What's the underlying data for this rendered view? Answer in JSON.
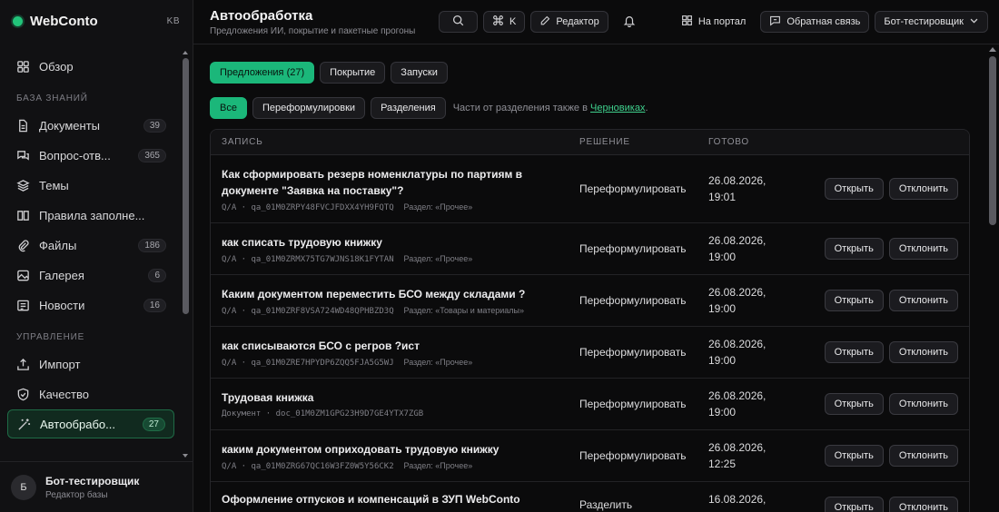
{
  "sidebar": {
    "brand": "WebConto",
    "kb_badge": "KB",
    "top_item": {
      "label": "Обзор"
    },
    "sections": [
      {
        "title": "БАЗА ЗНАНИЙ",
        "items": [
          {
            "label": "Документы",
            "count": "39",
            "icon": "document-icon"
          },
          {
            "label": "Вопрос-отв...",
            "count": "365",
            "icon": "chat-icon"
          },
          {
            "label": "Темы",
            "count": "",
            "icon": "layers-icon"
          },
          {
            "label": "Правила заполне...",
            "count": "",
            "icon": "book-icon"
          },
          {
            "label": "Файлы",
            "count": "186",
            "icon": "paperclip-icon"
          },
          {
            "label": "Галерея",
            "count": "6",
            "icon": "image-icon"
          },
          {
            "label": "Новости",
            "count": "16",
            "icon": "news-icon"
          }
        ]
      },
      {
        "title": "УПРАВЛЕНИЕ",
        "items": [
          {
            "label": "Импорт",
            "count": "",
            "icon": "upload-icon"
          },
          {
            "label": "Качество",
            "count": "",
            "icon": "shield-icon"
          },
          {
            "label": "Автообрабо...",
            "count": "27",
            "icon": "wand-icon",
            "active": true
          }
        ]
      }
    ],
    "user": {
      "initial": "Б",
      "name": "Бот-тестировщик",
      "role": "Редактор базы"
    }
  },
  "header": {
    "title": "Автообработка",
    "subtitle": "Предложения ИИ, покрытие и пакетные прогоны",
    "shortcut_key": "K",
    "editor_label": "Редактор",
    "portal_label": "На портал",
    "feedback_label": "Обратная связь",
    "user_menu_label": "Бот-тестировщик"
  },
  "tabs": [
    {
      "label": "Предложения (27)",
      "active": true
    },
    {
      "label": "Покрытие"
    },
    {
      "label": "Запуски"
    }
  ],
  "filters": {
    "options": [
      {
        "label": "Все",
        "active": true
      },
      {
        "label": "Переформулировки"
      },
      {
        "label": "Разделения"
      }
    ],
    "hint_prefix": "Части от разделения также в",
    "hint_link": "Черновиках",
    "hint_suffix": "."
  },
  "table": {
    "headers": {
      "record": "ЗАПИСЬ",
      "decision": "РЕШЕНИЕ",
      "ready": "ГОТОВО"
    },
    "open_label": "Открыть",
    "reject_label": "Отклонить",
    "rows": [
      {
        "title": "Как сформировать резерв номенклатуры по партиям в документе \"Заявка на поставку\"?",
        "meta": "Q/A · qa_01M0ZRPY48FVCJFDXX4YH9FQTQ",
        "section": "Раздел: «Прочее»",
        "decision": "Переформулировать",
        "date": "26.08.2026,",
        "time": "19:01"
      },
      {
        "title": "как списать трудовую книжку",
        "meta": "Q/A · qa_01M0ZRMX75TG7WJNS18K1FYTAN",
        "section": "Раздел: «Прочее»",
        "decision": "Переформулировать",
        "date": "26.08.2026,",
        "time": "19:00"
      },
      {
        "title": "Каким документом переместить БСО между складами ?",
        "meta": "Q/A · qa_01M0ZRF8VSA724WD48QPHBZD3Q",
        "section": "Раздел: «Товары и материалы»",
        "decision": "Переформулировать",
        "date": "26.08.2026,",
        "time": "19:00"
      },
      {
        "title": "как списываются БСО с регров ?ист",
        "meta": "Q/A · qa_01M0ZRE7HPYDP6ZQQ5FJA5G5WJ",
        "section": "Раздел: «Прочее»",
        "decision": "Переформулировать",
        "date": "26.08.2026,",
        "time": "19:00"
      },
      {
        "title": "Трудовая книжка",
        "meta": "Документ · doc_01M0ZM1GPG23H9D7GE4YTX7ZGB",
        "section": "",
        "decision": "Переформулировать",
        "date": "26.08.2026,",
        "time": "19:00"
      },
      {
        "title": "каким документом оприходовать трудовую книжку",
        "meta": "Q/A · qa_01M0ZRG67QC16W3FZ0W5Y56CK2",
        "section": "Раздел: «Прочее»",
        "decision": "Переформулировать",
        "date": "26.08.2026,",
        "time": "12:25"
      },
      {
        "title": "Оформление отпусков и компенсаций в ЗУП WebConto",
        "meta": "",
        "section": "",
        "decision": "Разделить",
        "date": "16.08.2026,",
        "time": ""
      }
    ]
  }
}
